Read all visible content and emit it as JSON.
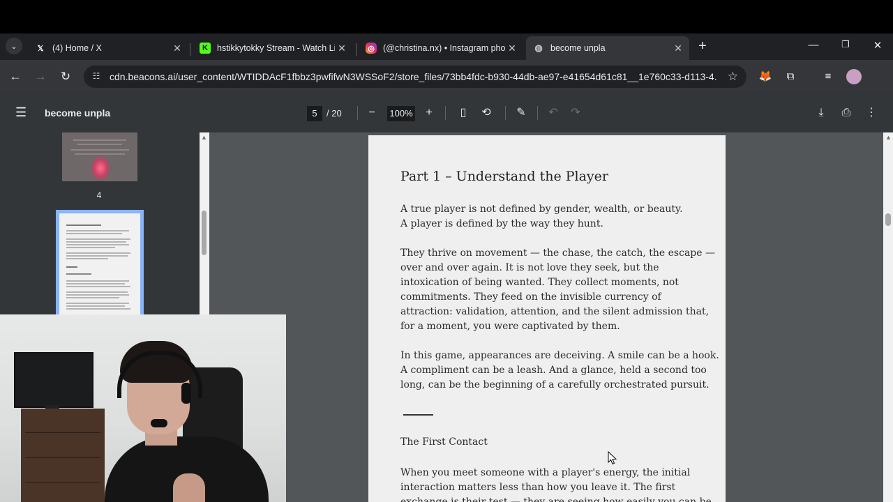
{
  "tabs": [
    {
      "title": "(4) Home / X",
      "icon": "x-logo-icon",
      "active": false
    },
    {
      "title": "hstikkytokky Stream - Watch Live",
      "icon": "kick-logo-icon",
      "active": false
    },
    {
      "title": "(@christina.nx) • Instagram photos",
      "icon": "instagram-logo-icon",
      "active": false
    },
    {
      "title": "become unpla",
      "icon": "globe-icon",
      "active": true
    }
  ],
  "address_bar": {
    "url": "cdn.beacons.ai/user_content/WTIDDAcF1fbbz3pwfifwN3WSSoF2/store_files/73bb4fdc-b930-44db-ae97-e41654d61c81__1e760c33-d113-4..."
  },
  "pdf_viewer": {
    "title": "become unpla",
    "current_page": "5",
    "total_pages": "/ 20",
    "zoom": "100%",
    "thumbnail_label": "4"
  },
  "page": {
    "heading": "Part 1 – Understand the Player",
    "paragraphs": [
      [
        "A true player is not defined by gender, wealth, or beauty.",
        "A player is defined by the way they hunt."
      ],
      [
        "They thrive on movement — the chase, the catch, the escape —",
        "over and over again. It is not love they seek, but the",
        "intoxication of being wanted. They collect moments, not",
        "commitments. They feed on the invisible currency of",
        "attraction: validation, attention, and the silent admission that,",
        "for a moment, you were captivated by them."
      ],
      [
        "In this game, appearances are deceiving. A smile can be a hook.",
        "A compliment can be a leash. And a glance, held a second too",
        "long, can be the beginning of a carefully orchestrated pursuit."
      ]
    ],
    "subheading": "The First Contact",
    "last_paragraph": [
      "When you meet someone with a player's energy, the initial",
      "interaction matters less than how you leave it. The first",
      "exchange is their test — they are seeing how easily you can be"
    ]
  }
}
